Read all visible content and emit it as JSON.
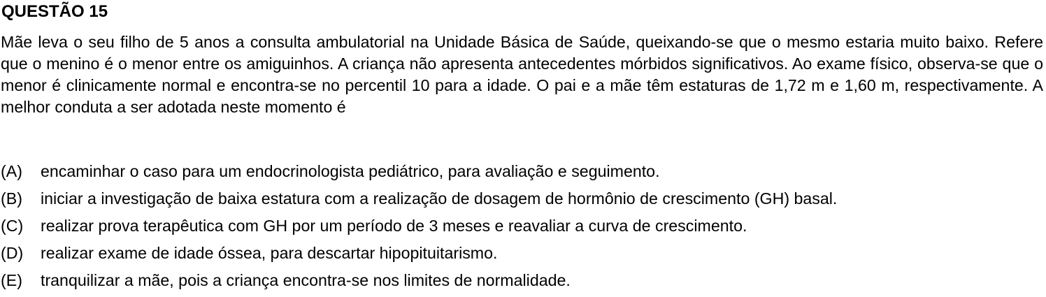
{
  "question": {
    "title": "QUESTÃO 15",
    "stem": "Mãe leva o seu filho de 5 anos a consulta ambulatorial na Unidade Básica de Saúde, queixando-se que o mesmo estaria muito baixo. Refere que o menino é o menor entre os amiguinhos. A criança não apresenta antecedentes mórbidos significativos. Ao exame físico, observa-se que o menor é clinicamente normal e encontra-se no percentil 10 para a idade. O pai e a mãe têm estaturas de 1,72 m e 1,60 m, respectivamente. A melhor conduta a ser adotada neste momento é",
    "options": [
      {
        "letter": "(A)",
        "text": "encaminhar o caso para um endocrinologista pediátrico, para avaliação e seguimento."
      },
      {
        "letter": "(B)",
        "text": "iniciar a investigação de baixa estatura com a realização de dosagem de hormônio de crescimento (GH) basal."
      },
      {
        "letter": "(C)",
        "text": "realizar prova terapêutica com GH por um período de 3 meses e reavaliar a curva de crescimento."
      },
      {
        "letter": "(D)",
        "text": "realizar exame de idade óssea, para descartar hipopituitarismo."
      },
      {
        "letter": "(E)",
        "text": "tranquilizar a mãe, pois a criança encontra-se nos limites de normalidade."
      }
    ]
  }
}
